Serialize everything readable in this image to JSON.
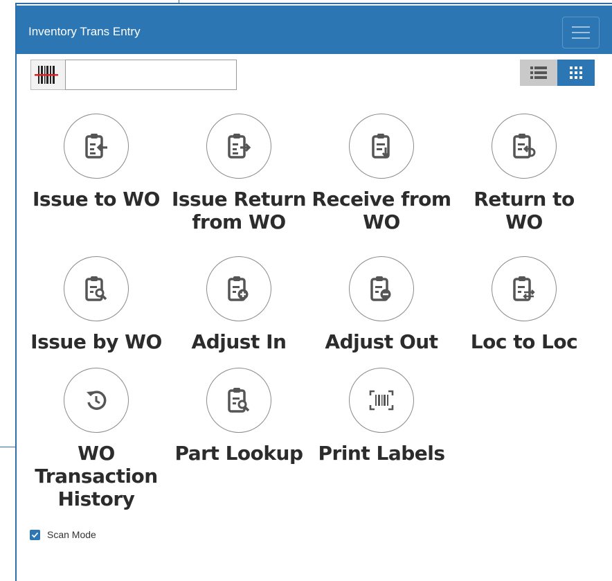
{
  "window": {
    "title": "Inventory Trans Entry"
  },
  "header": {
    "menu_icon": "hamburger-menu-icon"
  },
  "toolbar": {
    "scan_icon": "barcode-scan-icon",
    "scan_input_value": "",
    "view_list_icon": "list-view-icon",
    "view_grid_icon": "grid-view-icon",
    "active_view": "grid"
  },
  "tiles": [
    {
      "label": "Issue to WO",
      "icon": "clipboard-arrow-left-icon"
    },
    {
      "label": "Issue Return from WO",
      "icon": "clipboard-arrow-right-icon"
    },
    {
      "label": "Receive from WO",
      "icon": "clipboard-arrow-down-icon"
    },
    {
      "label": "Return to WO",
      "icon": "clipboard-return-icon"
    },
    {
      "label": "Issue by WO",
      "icon": "clipboard-search-icon"
    },
    {
      "label": "Adjust In",
      "icon": "clipboard-plus-icon"
    },
    {
      "label": "Adjust Out",
      "icon": "clipboard-minus-icon"
    },
    {
      "label": "Loc to Loc",
      "icon": "clipboard-transfer-icon"
    },
    {
      "label": "WO Transaction History",
      "icon": "history-icon"
    },
    {
      "label": "Part Lookup",
      "icon": "clipboard-search-icon"
    },
    {
      "label": "Print Labels",
      "icon": "barcode-icon"
    }
  ],
  "footer": {
    "scan_mode_label": "Scan Mode",
    "scan_mode_checked": true
  },
  "colors": {
    "primary": "#2c77b3",
    "text": "#2c2c2c",
    "toggle_inactive": "#c9c9c9"
  }
}
